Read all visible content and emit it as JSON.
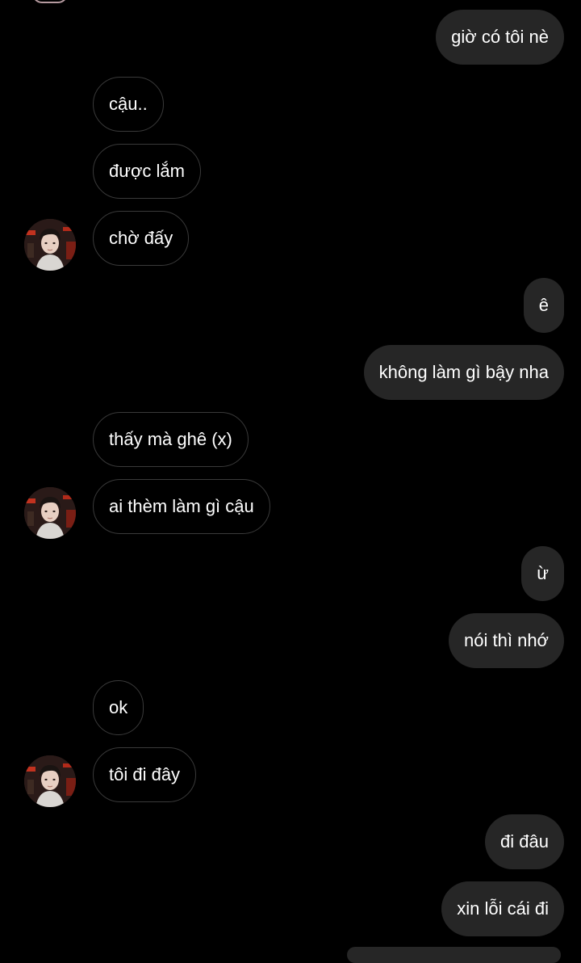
{
  "conversation": {
    "messages": [
      {
        "side": "sent",
        "text": "giờ có tôi nè"
      },
      {
        "side": "recv",
        "text": "cậu.."
      },
      {
        "side": "recv",
        "text": "được lắm"
      },
      {
        "side": "recv",
        "text": "chờ đấy"
      },
      {
        "side": "sent",
        "text": "ê"
      },
      {
        "side": "sent",
        "text": "không làm gì bậy nha"
      },
      {
        "side": "recv",
        "text": "thấy mà ghê (x)"
      },
      {
        "side": "recv",
        "text": "ai thèm làm gì cậu"
      },
      {
        "side": "sent",
        "text": "ừ"
      },
      {
        "side": "sent",
        "text": "nói thì nhớ"
      },
      {
        "side": "recv",
        "text": "ok"
      },
      {
        "side": "recv",
        "text": "tôi đi đây"
      },
      {
        "side": "sent",
        "text": "đi đâu"
      },
      {
        "side": "sent",
        "text": "xin lỗi cái đi"
      }
    ]
  },
  "colors": {
    "background": "#000000",
    "sent_bubble": "#262626",
    "received_border": "#3a3a3a",
    "text": "#ffffff"
  },
  "icons": {
    "avatar": "contact-avatar-icon"
  }
}
